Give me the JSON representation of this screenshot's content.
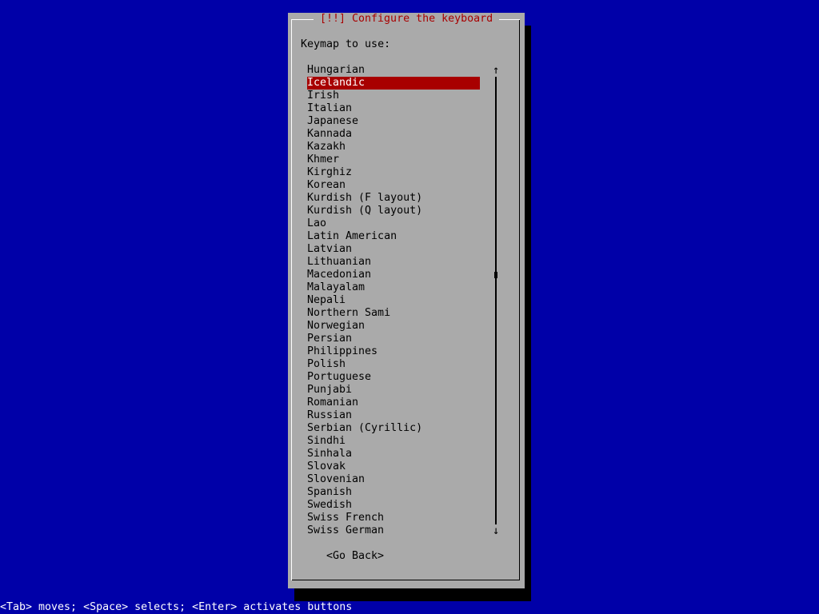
{
  "dialog": {
    "title": "[!!] Configure the keyboard",
    "prompt": "Keymap to use:",
    "go_back_label": "<Go Back>"
  },
  "keymaps": {
    "selected_index": 1,
    "items": [
      "Hungarian",
      "Icelandic",
      "Irish",
      "Italian",
      "Japanese",
      "Kannada",
      "Kazakh",
      "Khmer",
      "Kirghiz",
      "Korean",
      "Kurdish (F layout)",
      "Kurdish (Q layout)",
      "Lao",
      "Latin American",
      "Latvian",
      "Lithuanian",
      "Macedonian",
      "Malayalam",
      "Nepali",
      "Northern Sami",
      "Norwegian",
      "Persian",
      "Philippines",
      "Polish",
      "Portuguese",
      "Punjabi",
      "Romanian",
      "Russian",
      "Serbian (Cyrillic)",
      "Sindhi",
      "Sinhala",
      "Slovak",
      "Slovenian",
      "Spanish",
      "Swedish",
      "Swiss French",
      "Swiss German"
    ]
  },
  "scrollbar": {
    "up_icon": "↑",
    "down_icon": "↓"
  },
  "help": "<Tab> moves; <Space> selects; <Enter> activates buttons",
  "colors": {
    "background": "#0000a8",
    "dialog": "#aaaaaa",
    "title_text": "#a80000",
    "selection": "#a80000",
    "help_text": "#ffffff"
  }
}
